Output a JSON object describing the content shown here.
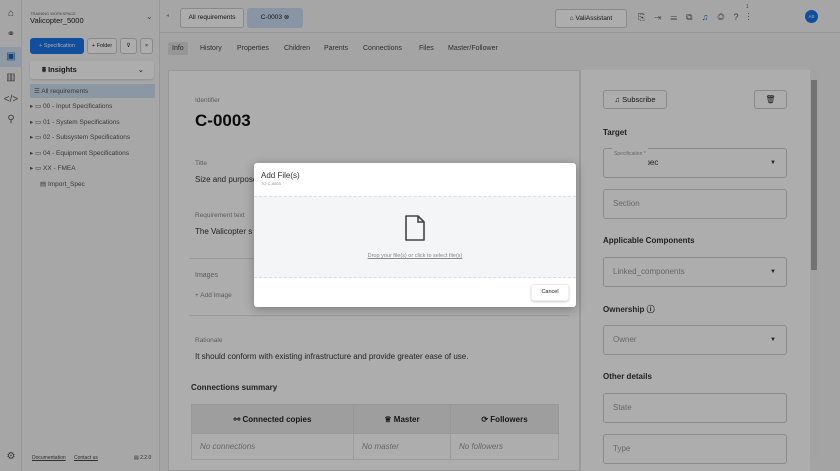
{
  "workspace": {
    "label": "TRAINING WORKSPACE",
    "name": "Valicopter_5000"
  },
  "sidebar": {
    "add_spec": "+ Specification",
    "add_folder": "+ Folder",
    "insights": "Insights",
    "items": [
      {
        "label": "All requirements"
      },
      {
        "label": "00 - Input Specifications"
      },
      {
        "label": "01 - System Specifications"
      },
      {
        "label": "02 - Subsystem Specifications"
      },
      {
        "label": "04 - Equipment Specifications"
      },
      {
        "label": "XX - FMEA"
      },
      {
        "label": "Import_Spec"
      }
    ],
    "footer": {
      "documentation": "Documentation",
      "contact": "Contact us",
      "version": "2.2.0"
    }
  },
  "topbar": {
    "tabs": [
      {
        "label": "All requirements"
      },
      {
        "label": "C-0003"
      }
    ],
    "assistant": "ValiAssistant",
    "notif_count": "1",
    "avatar": "AS"
  },
  "tabs": [
    "Info",
    "History",
    "Properties",
    "Children",
    "Parents",
    "Connections",
    "Files",
    "Master/Follower"
  ],
  "info": {
    "identifier_label": "Identifier",
    "identifier": "C-0003",
    "title_label": "Title",
    "title": "Size and purpose",
    "req_label": "Requirement text",
    "req": "The Valicopter s",
    "images_label": "Images",
    "add_image": "+ Add Image",
    "rationale_label": "Rationale",
    "rationale": "It should conform with existing infrastructure and provide greater ease of use.",
    "connections_title": "Connections summary",
    "columns": [
      "Connected copies",
      "Master",
      "Followers"
    ],
    "values": [
      "No connections",
      "No master",
      "No followers"
    ]
  },
  "right": {
    "subscribe": "Subscribe",
    "target": "Target",
    "spec_label": "Specification *",
    "spec_value": "Import_Spec",
    "section": "Section",
    "applicable": "Applicable Components",
    "linked": "Linked_components",
    "ownership": "Ownership",
    "owner": "Owner",
    "other": "Other details",
    "state": "State",
    "type": "Type"
  },
  "modal": {
    "title": "Add File(s)",
    "subtitle": "TO C-0003",
    "drop": "Drop your file(s) or click to select file(s)",
    "cancel": "Cancel"
  },
  "colors": {
    "primary": "#1a73e8",
    "active_tab": "#c9dcf2"
  }
}
